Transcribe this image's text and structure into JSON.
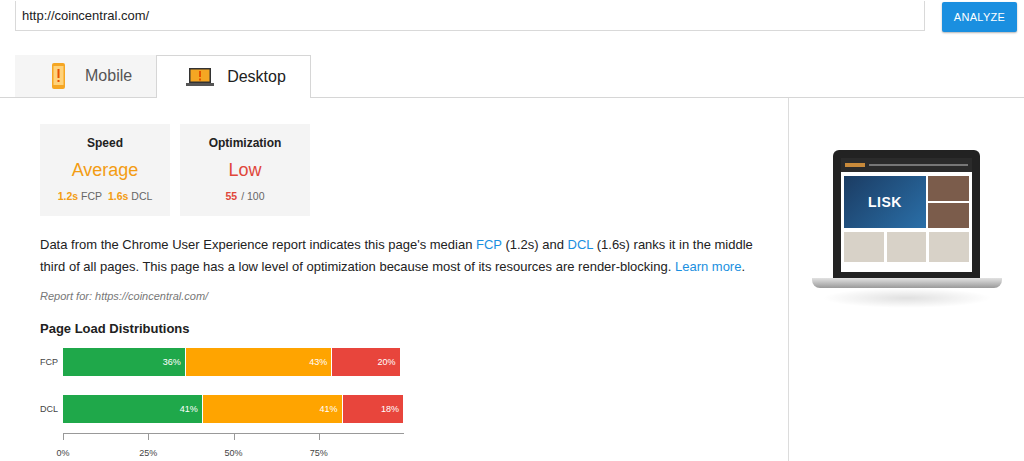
{
  "url_field": {
    "value": "http://coincentral.com/"
  },
  "analyze_button": "ANALYZE",
  "tabs": [
    {
      "label": "Mobile",
      "selected": false
    },
    {
      "label": "Desktop",
      "selected": true
    }
  ],
  "speed_card": {
    "title": "Speed",
    "rating": "Average",
    "color": "#f39c12",
    "metrics": [
      {
        "value": "1.2s",
        "label": "FCP"
      },
      {
        "value": "1.6s",
        "label": "DCL"
      }
    ]
  },
  "optimization_card": {
    "title": "Optimization",
    "rating": "Low",
    "color": "#e0473a",
    "score": "55",
    "max": "/ 100"
  },
  "description": {
    "segments": [
      {
        "text": "Data from the Chrome User Experience report indicates this page's median ",
        "link": false
      },
      {
        "text": "FCP",
        "link": true
      },
      {
        "text": " (1.2s) and ",
        "link": false
      },
      {
        "text": "DCL",
        "link": true
      },
      {
        "text": " (1.6s) ranks it in the middle third of all pages. This page has a low level of optimization because most of its resources are render-blocking. ",
        "link": false
      },
      {
        "text": "Learn more",
        "link": true
      },
      {
        "text": ".",
        "link": false
      }
    ]
  },
  "report_for": "Report for: https://coincentral.com/",
  "chart": {
    "title": "Page Load Distributions",
    "segments": [
      {
        "color": "#1fa84a"
      },
      {
        "color": "#ffa400"
      },
      {
        "color": "#e8453c"
      }
    ],
    "rows": [
      {
        "label": "FCP",
        "values": [
          36,
          43,
          20
        ],
        "texts": [
          "36%",
          "43%",
          "20%"
        ]
      },
      {
        "label": "DCL",
        "values": [
          41,
          41,
          18
        ],
        "texts": [
          "41%",
          "41%",
          "18%"
        ]
      }
    ],
    "ticks": [
      "0%",
      "25%",
      "50%",
      "75%"
    ]
  },
  "thumbnail": {
    "hero_text": "LISK"
  }
}
